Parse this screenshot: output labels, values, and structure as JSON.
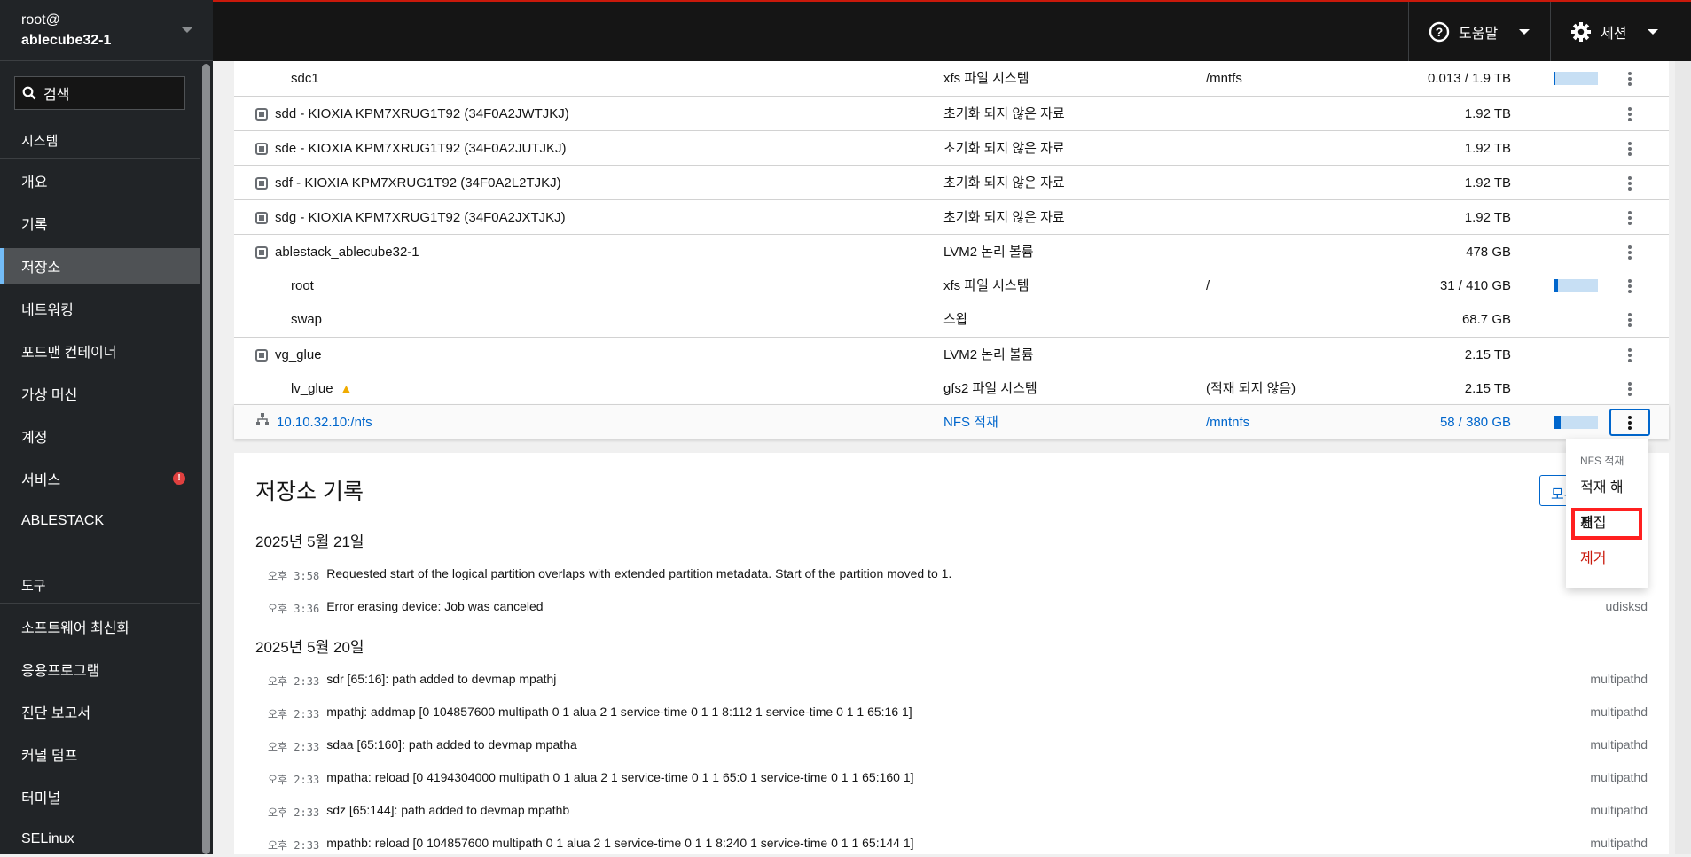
{
  "host": {
    "user": "root@",
    "name": "ablecube32-1"
  },
  "search": {
    "placeholder": "검색"
  },
  "sidebar": {
    "system_label": "시스템",
    "tools_label": "도구",
    "system_items": [
      {
        "label": "개요"
      },
      {
        "label": "기록"
      },
      {
        "label": "저장소",
        "active": true
      },
      {
        "label": "네트워킹"
      },
      {
        "label": "포드맨 컨테이너"
      },
      {
        "label": "가상 머신"
      },
      {
        "label": "계정"
      },
      {
        "label": "서비스",
        "badge": "!"
      },
      {
        "label": "ABLESTACK"
      }
    ],
    "tool_items": [
      {
        "label": "소프트웨어 최신화"
      },
      {
        "label": "응용프로그램"
      },
      {
        "label": "진단 보고서"
      },
      {
        "label": "커널 덤프"
      },
      {
        "label": "터미널"
      },
      {
        "label": "SELinux"
      }
    ]
  },
  "topbar": {
    "help": "도움말",
    "session": "세션",
    "accent": "#c9190b"
  },
  "table": {
    "rows": [
      {
        "name": "sdc1",
        "type": "xfs 파일 시스템",
        "mount": "/mntfs",
        "size": "0.013 / 1.9 TB",
        "usage": 0.007
      },
      {
        "name": "sdd - KIOXIA KPM7XRUG1T92 (34F0A2JWTJKJ)",
        "type": "초기화 되지 않은 자료",
        "size": "1.92 TB",
        "icon": "disk-icon"
      },
      {
        "name": "sde - KIOXIA KPM7XRUG1T92 (34F0A2JUTJKJ)",
        "type": "초기화 되지 않은 자료",
        "size": "1.92 TB",
        "icon": "disk-icon"
      },
      {
        "name": "sdf - KIOXIA KPM7XRUG1T92 (34F0A2L2TJKJ)",
        "type": "초기화 되지 않은 자료",
        "size": "1.92 TB",
        "icon": "disk-icon"
      },
      {
        "name": "sdg - KIOXIA KPM7XRUG1T92 (34F0A2JXTJKJ)",
        "type": "초기화 되지 않은 자료",
        "size": "1.92 TB",
        "icon": "disk-icon"
      },
      {
        "name": "ablestack_ablecube32-1",
        "type": "LVM2 논리 볼륨",
        "size": "478 GB",
        "icon": "volume-group-icon"
      },
      {
        "name": "root",
        "type": "xfs 파일 시스템",
        "mount": "/",
        "size": "31 / 410 GB",
        "usage": 0.076
      },
      {
        "name": "swap",
        "type": "스왑",
        "size": "68.7 GB"
      },
      {
        "name": "vg_glue",
        "type": "LVM2 논리 볼륨",
        "size": "2.15 TB",
        "icon": "volume-group-icon"
      },
      {
        "name": "lv_glue",
        "type": "gfs2 파일 시스템",
        "mount": "(적재 되지 않음)",
        "size": "2.15 TB",
        "warning": true
      },
      {
        "name": "10.10.32.10:/nfs",
        "type": "NFS 적재",
        "mount": "/mntnfs",
        "size": "58 / 380 GB",
        "usage": 0.153,
        "icon": "network-icon",
        "selected": true
      }
    ]
  },
  "menu": {
    "header": "NFS 적재",
    "items": [
      "적재 해제",
      "편집",
      "제거"
    ]
  },
  "log": {
    "title": "저장소 기록",
    "more_button": "모두 보기",
    "groups": [
      {
        "date": "2025년 5월 21일",
        "entries": [
          {
            "time": "오후 3:58",
            "msg": "Requested start of the logical partition overlaps with extended partition metadata. Start of the partition moved to 1.",
            "src": ""
          },
          {
            "time": "오후 3:36",
            "msg": "Error erasing device: Job was canceled",
            "src": "udisksd"
          }
        ]
      },
      {
        "date": "2025년 5월 20일",
        "entries": [
          {
            "time": "오후 2:33",
            "msg": "sdr [65:16]: path added to devmap mpathj",
            "src": "multipathd"
          },
          {
            "time": "오후 2:33",
            "msg": "mpathj: addmap [0 104857600 multipath 0 1 alua 2 1 service-time 0 1 1 8:112 1 service-time 0 1 1 65:16 1]",
            "src": "multipathd"
          },
          {
            "time": "오후 2:33",
            "msg": "sdaa [65:160]: path added to devmap mpatha",
            "src": "multipathd"
          },
          {
            "time": "오후 2:33",
            "msg": "mpatha: reload [0 4194304000 multipath 0 1 alua 2 1 service-time 0 1 1 65:0 1 service-time 0 1 1 65:160 1]",
            "src": "multipathd"
          },
          {
            "time": "오후 2:33",
            "msg": "sdz [65:144]: path added to devmap mpathb",
            "src": "multipathd"
          },
          {
            "time": "오후 2:33",
            "msg": "mpathb: reload [0 104857600 multipath 0 1 alua 2 1 service-time 0 1 1 8:240 1 service-time 0 1 1 65:144 1]",
            "src": "multipathd"
          }
        ]
      }
    ]
  }
}
